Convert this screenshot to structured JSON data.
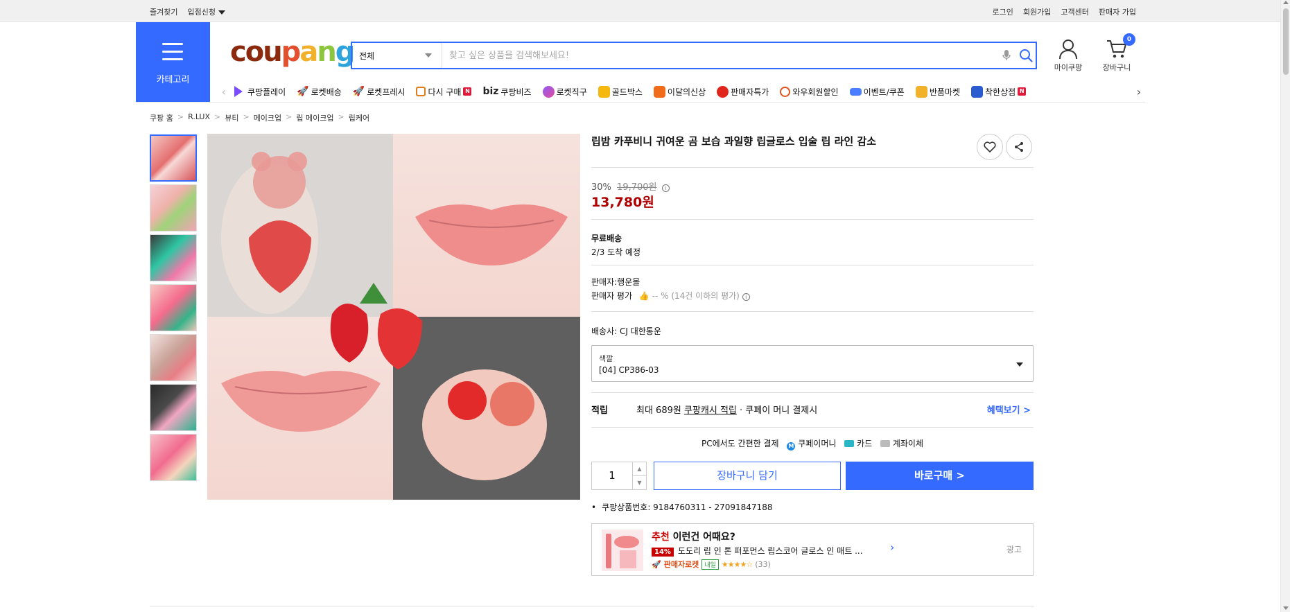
{
  "topbar": {
    "left": [
      "즐겨찾기",
      "입점신청"
    ],
    "right": [
      "로그인",
      "회원가입",
      "고객센터",
      "판매자 가입"
    ]
  },
  "header": {
    "category_label": "카테고리",
    "logo": [
      "cou",
      "p",
      "a",
      "n",
      "g"
    ],
    "search_category": "전체",
    "search_placeholder": "찾고 싶은 상품을 검색해보세요!",
    "mypage_label": "마이쿠팡",
    "cart_label": "장바구니",
    "cart_count": "0",
    "accent": "#346aff"
  },
  "catnav": [
    {
      "label": "쿠팡플레이",
      "icon": "play-icon"
    },
    {
      "label": "로켓배송",
      "icon": "rocket-icon"
    },
    {
      "label": "로켓프레시",
      "icon": "rocket-fresh-icon"
    },
    {
      "label": "다시 구매",
      "icon": "rebuy-icon",
      "badge": "N"
    },
    {
      "label": "쿠팡비즈",
      "icon": "biz-icon",
      "prefix": "biz"
    },
    {
      "label": "로켓직구",
      "icon": "global-icon"
    },
    {
      "label": "골드박스",
      "icon": "goldbox-icon"
    },
    {
      "label": "이달의신상",
      "icon": "new-icon"
    },
    {
      "label": "판매자특가",
      "icon": "seller-deal-icon"
    },
    {
      "label": "와우회원할인",
      "icon": "wow-icon"
    },
    {
      "label": "이벤트/쿠폰",
      "icon": "coupon-icon"
    },
    {
      "label": "반품마켓",
      "icon": "return-market-icon"
    },
    {
      "label": "착한상점",
      "icon": "good-store-icon",
      "badge": "N"
    }
  ],
  "breadcrumb": [
    "쿠팡 홈",
    "R.LUX",
    "뷰티",
    "메이크업",
    "립 메이크업",
    "립케어"
  ],
  "product": {
    "title": "립밤 카푸비니 귀여운 곰 보습 과일향 립글로스 입술 립 라인 감소",
    "discount": "30%",
    "original_price": "19,700원",
    "price": "13,780원",
    "shipping_title": "무료배송",
    "arrival": "2/3 도착 예정",
    "seller": "판매자:행운몰",
    "seller_rating_label": "판매자 평가",
    "seller_rating_value": "-- %",
    "seller_rating_note": "(14건 이하의 평가)",
    "carrier": "배송사:  CJ 대한통운",
    "option_label": "색깔",
    "option_value": "[04] CP386-03",
    "reward_key": "적립",
    "reward_pre": "최대 689원 ",
    "reward_link": "쿠팡캐시 적립",
    "reward_post": " · 쿠페이 머니 결제시",
    "reward_more": "혜택보기 >",
    "pay_title": "PC에서도 간편한 결제",
    "pay_money": "쿠페이머니",
    "pay_card": "카드",
    "pay_bank": "계좌이체",
    "qty": "1",
    "add_cart": "장바구니 담기",
    "buy_now": "바로구매 >",
    "product_id": "쿠팡상품번호: 9184760311 - 27091847188"
  },
  "recommend": {
    "title_red": "추천",
    "title_rest": " 이런건 어때요?",
    "discount": "14%",
    "name": "도도리 립 인 톤 퍼포먼스 립스코어 글로스 인 매트 ...",
    "rocket": "판매자로켓",
    "tomorrow": "내일",
    "stars": "★★★★☆",
    "count": "(33)",
    "ad": "광고"
  }
}
